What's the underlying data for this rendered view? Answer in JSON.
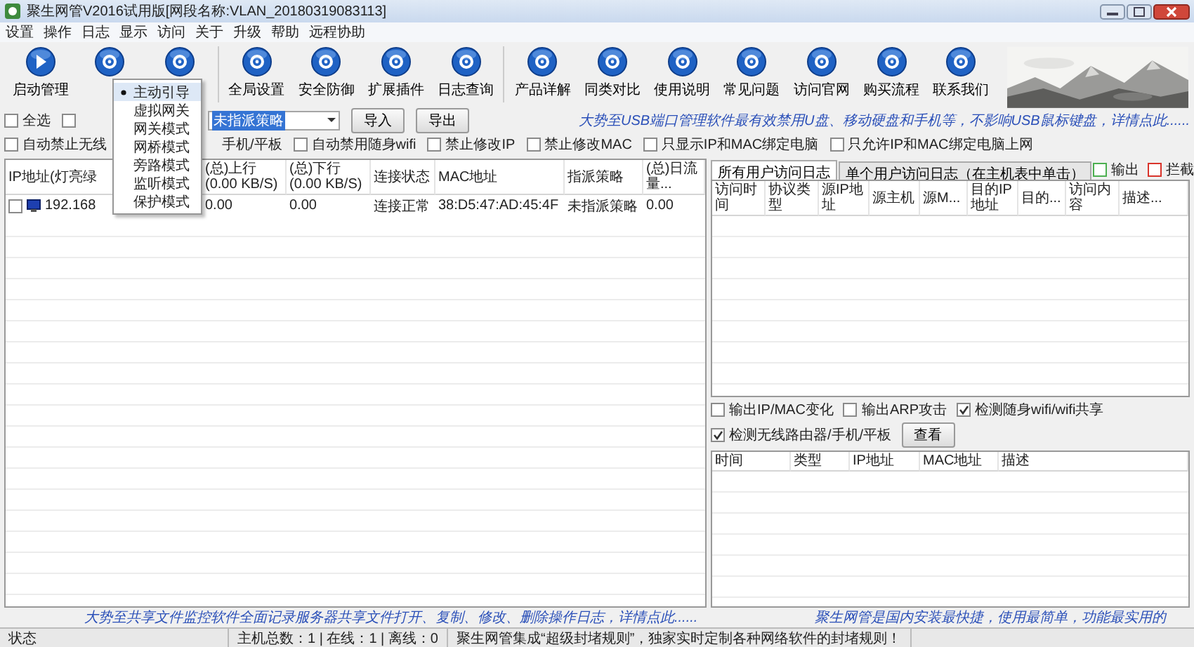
{
  "window": {
    "title": "聚生网管V2016试用版[网段名称:VLAN_20180319083113]"
  },
  "menu_bar": [
    "设置",
    "操作",
    "日志",
    "显示",
    "访问",
    "关于",
    "升级",
    "帮助",
    "远程协助"
  ],
  "toolbar": [
    {
      "label": "启动管理",
      "covered": false
    },
    {
      "covered": true
    },
    {
      "covered": true
    },
    {
      "label": "全局设置",
      "covered": false
    },
    {
      "label": "安全防御",
      "covered": false
    },
    {
      "label": "扩展插件",
      "covered": false
    },
    {
      "label": "日志查询",
      "covered": false
    },
    {
      "label": "产品详解",
      "covered": false
    },
    {
      "label": "同类对比",
      "covered": false
    },
    {
      "label": "使用说明",
      "covered": false
    },
    {
      "label": "常见问题",
      "covered": false
    },
    {
      "label": "访问官网",
      "covered": false
    },
    {
      "label": "购买流程",
      "covered": false
    },
    {
      "label": "联系我们",
      "covered": false
    }
  ],
  "dropdown_menu": {
    "items": [
      {
        "label": "主动引导",
        "selected": true
      },
      {
        "label": "虚拟网关",
        "selected": false
      },
      {
        "label": "网关模式",
        "selected": false
      },
      {
        "label": "网桥模式",
        "selected": false
      },
      {
        "label": "旁路模式",
        "selected": false
      },
      {
        "label": "监听模式",
        "selected": false
      },
      {
        "label": "保护模式",
        "selected": false
      }
    ]
  },
  "filter_row": {
    "select_all": {
      "label": "全选",
      "checked": false
    },
    "second_checked": false,
    "policy_select": {
      "value": "未指派策略"
    },
    "buttons": [
      "导入",
      "导出"
    ],
    "promo_link": "大势至USB端口管理软件最有效禁用U盘、移动硬盘和手机等，不影响USB鼠标键盘，详情点此......"
  },
  "options": [
    {
      "label": "自动禁止无线",
      "tail": "手机/平板",
      "checked": false
    },
    {
      "label": "自动禁用随身wifi",
      "checked": false
    },
    {
      "label": "禁止修改IP",
      "checked": false
    },
    {
      "label": "禁止修改MAC",
      "checked": false
    },
    {
      "label": "只显示IP和MAC绑定电脑",
      "checked": false
    },
    {
      "label": "只允许IP和MAC绑定电脑上网",
      "checked": false
    }
  ],
  "hosts_table": {
    "columns": [
      "IP地址(灯亮绿",
      "(总)上行(0.00 KB/S)",
      "(总)下行(0.00 KB/S)",
      "连接状态",
      "MAC地址",
      "指派策略",
      "(总)日流量..."
    ],
    "rows": [
      {
        "checked": false,
        "cells": [
          "192.168",
          "0.00",
          "0.00",
          "连接正常",
          "38:D5:47:AD:45:4F",
          "未指派策略",
          "0.00"
        ]
      }
    ]
  },
  "access_log": {
    "tabs": [
      {
        "label": "所有用户访问日志",
        "selected": true
      },
      {
        "label": "单个用户访问日志（在主机表中单击）",
        "selected": false
      }
    ],
    "legend": [
      {
        "label": "输出",
        "color": "#4caf50"
      },
      {
        "label": "拦截",
        "color": "#d9342b"
      }
    ],
    "columns": [
      "访问时间",
      "协议类型",
      "源IP地址",
      "源主机",
      "源M...",
      "目的IP地址",
      "目的...",
      "访问内容",
      "描述..."
    ]
  },
  "alerts": {
    "options": [
      {
        "label": "输出IP/MAC变化",
        "checked": false
      },
      {
        "label": "输出ARP攻击",
        "checked": false
      },
      {
        "label": "检测随身wifi/wifi共享",
        "checked": true
      },
      {
        "label": "检测无线路由器/手机/平板",
        "checked": true
      }
    ],
    "button": "查看",
    "columns": [
      "时间",
      "类型",
      "IP地址",
      "MAC地址",
      "描述"
    ]
  },
  "footer_links": [
    "大势至共享文件监控软件全面记录服务器共享文件打开、复制、修改、删除操作日志，详情点此......",
    "聚生网管是国内安装最快捷，使用最简单，功能最实用的"
  ],
  "status_bar": {
    "label": "状态",
    "counts": "主机总数：1 | 在线：1 | 离线：0",
    "message": "聚生网管集成“超级封堵规则”，独家实时定制各种网络软件的封堵规则！"
  }
}
